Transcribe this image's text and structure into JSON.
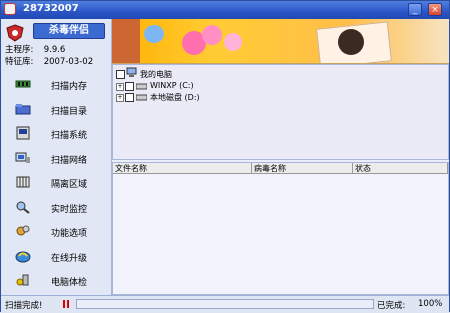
{
  "window": {
    "title": "28732007"
  },
  "app": {
    "brand": "杀毒伴侣"
  },
  "info": {
    "version_label": "主程序:",
    "version_value": "9.9.6",
    "sig_label": "特征库:",
    "sig_value": "2007-03-02"
  },
  "menu": [
    {
      "label": "扫描内存",
      "icon": "memory-icon"
    },
    {
      "label": "扫描目录",
      "icon": "folder-icon"
    },
    {
      "label": "扫描系统",
      "icon": "system-icon"
    },
    {
      "label": "扫描网络",
      "icon": "network-icon"
    },
    {
      "label": "隔离区域",
      "icon": "quarantine-icon"
    },
    {
      "label": "实时监控",
      "icon": "monitor-icon"
    },
    {
      "label": "功能选项",
      "icon": "options-icon"
    },
    {
      "label": "在线升级",
      "icon": "update-icon"
    },
    {
      "label": "电脑体检",
      "icon": "checkup-icon"
    }
  ],
  "tree": {
    "root": "我的电脑",
    "drives": [
      {
        "label": "WINXP (C:)"
      },
      {
        "label": "本地磁盘 (D:)"
      }
    ]
  },
  "table": {
    "columns": [
      "文件名称",
      "病毒名称",
      "状态"
    ]
  },
  "status": {
    "left_text": "扫描完成!",
    "done_label": "已完成:",
    "percent": "100%",
    "progress_fraction": 1
  },
  "colors": {
    "accent": "#2b55c6",
    "banner": "#ffb000"
  }
}
